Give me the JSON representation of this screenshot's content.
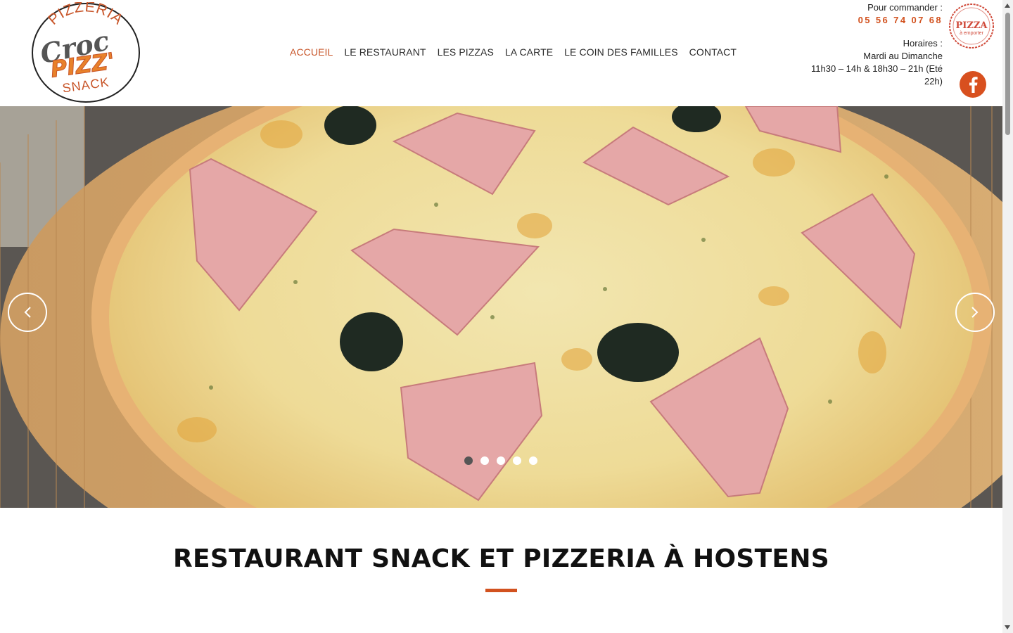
{
  "logo": {
    "top_text": "PIZZERIA",
    "script_text": "Croc",
    "mid_text": "PIZZ'",
    "bottom_text": "SNACK",
    "colors": {
      "ring": "#222222",
      "top": "#c8562a",
      "script": "#555555",
      "pizz": "#e8812a",
      "outline": "#c8562a"
    }
  },
  "nav": {
    "items": [
      {
        "label": "ACCUEIL",
        "active": true
      },
      {
        "label": "LE RESTAURANT"
      },
      {
        "label": "LES PIZZAS"
      },
      {
        "label": "LA CARTE"
      },
      {
        "label": "LE COIN DES FAMILLES"
      },
      {
        "label": "CONTACT"
      }
    ],
    "active_color": "#c8562a"
  },
  "order": {
    "label": "Pour commander :",
    "phone": "05 56 74 07 68"
  },
  "hours": {
    "label": "Horaires :",
    "days": "Mardi au Dimanche",
    "times": "11h30 – 14h & 18h30 – 21h (Eté 22h)"
  },
  "stamp": {
    "line1": "PIZZA",
    "line2": "à emporter",
    "color": "#d04a3a"
  },
  "facebook": {
    "icon": "facebook-icon",
    "color": "#d8501f"
  },
  "hero": {
    "image": "pizza-ham-olives-photo",
    "prev_icon": "chevron-left-icon",
    "next_icon": "chevron-right-icon",
    "slide_count": 5,
    "active_slide": 1
  },
  "main": {
    "headline": "RESTAURANT SNACK ET PIZZERIA À HOSTENS",
    "accent": "#d2521f"
  }
}
